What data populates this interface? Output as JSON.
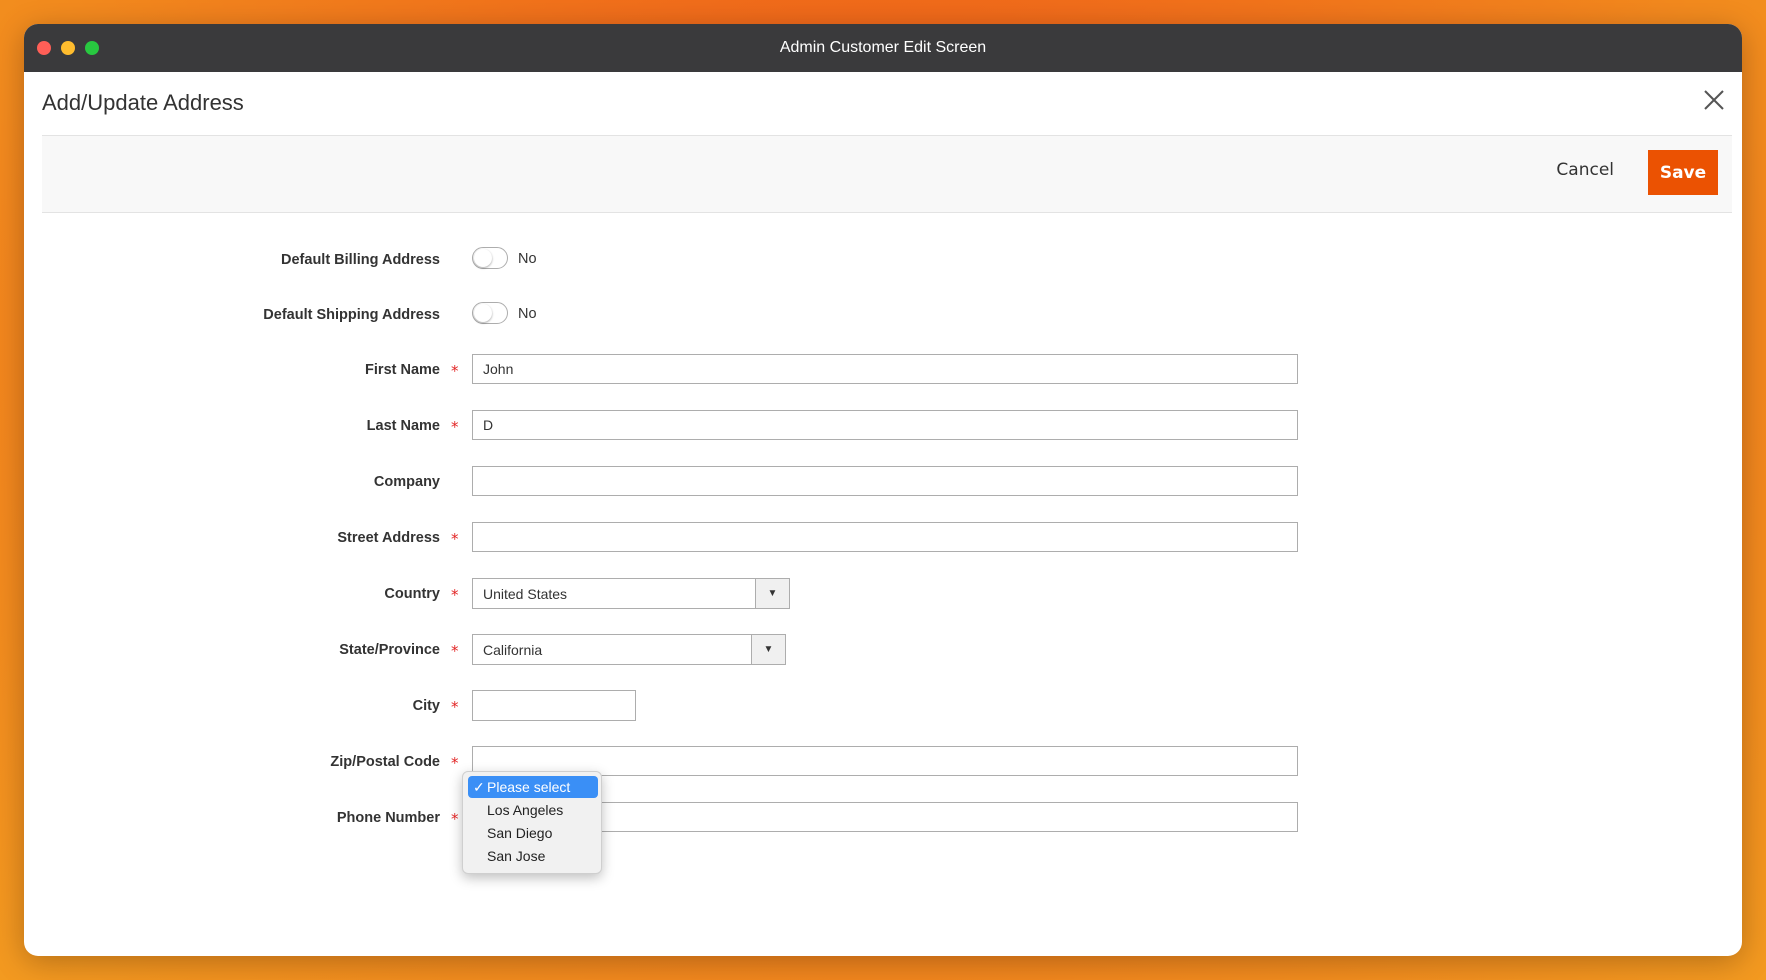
{
  "window": {
    "title": "Admin Customer Edit Screen"
  },
  "modal": {
    "title": "Add/Update Address",
    "cancel_label": "Cancel",
    "save_label": "Save"
  },
  "form": {
    "default_billing": {
      "label": "Default Billing Address",
      "value": "No"
    },
    "default_shipping": {
      "label": "Default Shipping Address",
      "value": "No"
    },
    "first_name": {
      "label": "First Name",
      "value": "John",
      "required": true
    },
    "last_name": {
      "label": "Last Name",
      "value": "D",
      "required": true
    },
    "company": {
      "label": "Company",
      "value": ""
    },
    "street": {
      "label": "Street Address",
      "value": "",
      "required": true
    },
    "country": {
      "label": "Country",
      "value": "United States",
      "required": true
    },
    "state": {
      "label": "State/Province",
      "value": "California",
      "required": true
    },
    "city": {
      "label": "City",
      "required": true,
      "options": [
        "Please select",
        "Los Angeles",
        "San Diego",
        "San Jose"
      ],
      "selected": "Please select"
    },
    "zip": {
      "label": "Zip/Postal Code",
      "value": "",
      "required": true
    },
    "phone": {
      "label": "Phone Number",
      "value": "",
      "required": true
    },
    "required_marker": "*"
  },
  "colors": {
    "accent": "#eb5202",
    "required": "#e22626",
    "selection": "#3a8ff6"
  }
}
